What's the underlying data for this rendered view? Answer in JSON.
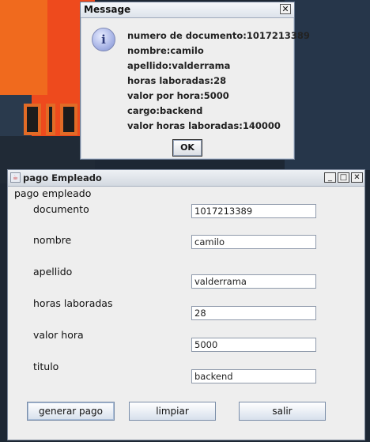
{
  "message_dialog": {
    "title": "Message",
    "close_glyph": "✕",
    "icon": "info-icon",
    "icon_glyph": "i",
    "lines": [
      "numero de documento:1017213389",
      "nombre:camilo",
      "apellido:valderrama",
      "horas laboradas:28",
      "valor por hora:5000",
      "cargo:backend",
      "valor horas laboradas:140000"
    ],
    "ok_label": "OK"
  },
  "frame": {
    "title": "pago Empleado",
    "app_icon": "java-icon",
    "minimize_glyph": "_",
    "maximize_glyph": "□",
    "close_glyph": "✕",
    "section_title": "pago empleado",
    "fields": [
      {
        "label": "documento",
        "value": "1017213389"
      },
      {
        "label": "nombre",
        "value": "camilo"
      },
      {
        "label": "apellido",
        "value": "valderrama"
      },
      {
        "label": "horas laboradas",
        "value": "28"
      },
      {
        "label": "valor hora",
        "value": "5000"
      },
      {
        "label": "titulo",
        "value": "backend"
      }
    ],
    "buttons": {
      "generate": "generar pago",
      "clear": "limpiar",
      "exit": "salir"
    }
  }
}
